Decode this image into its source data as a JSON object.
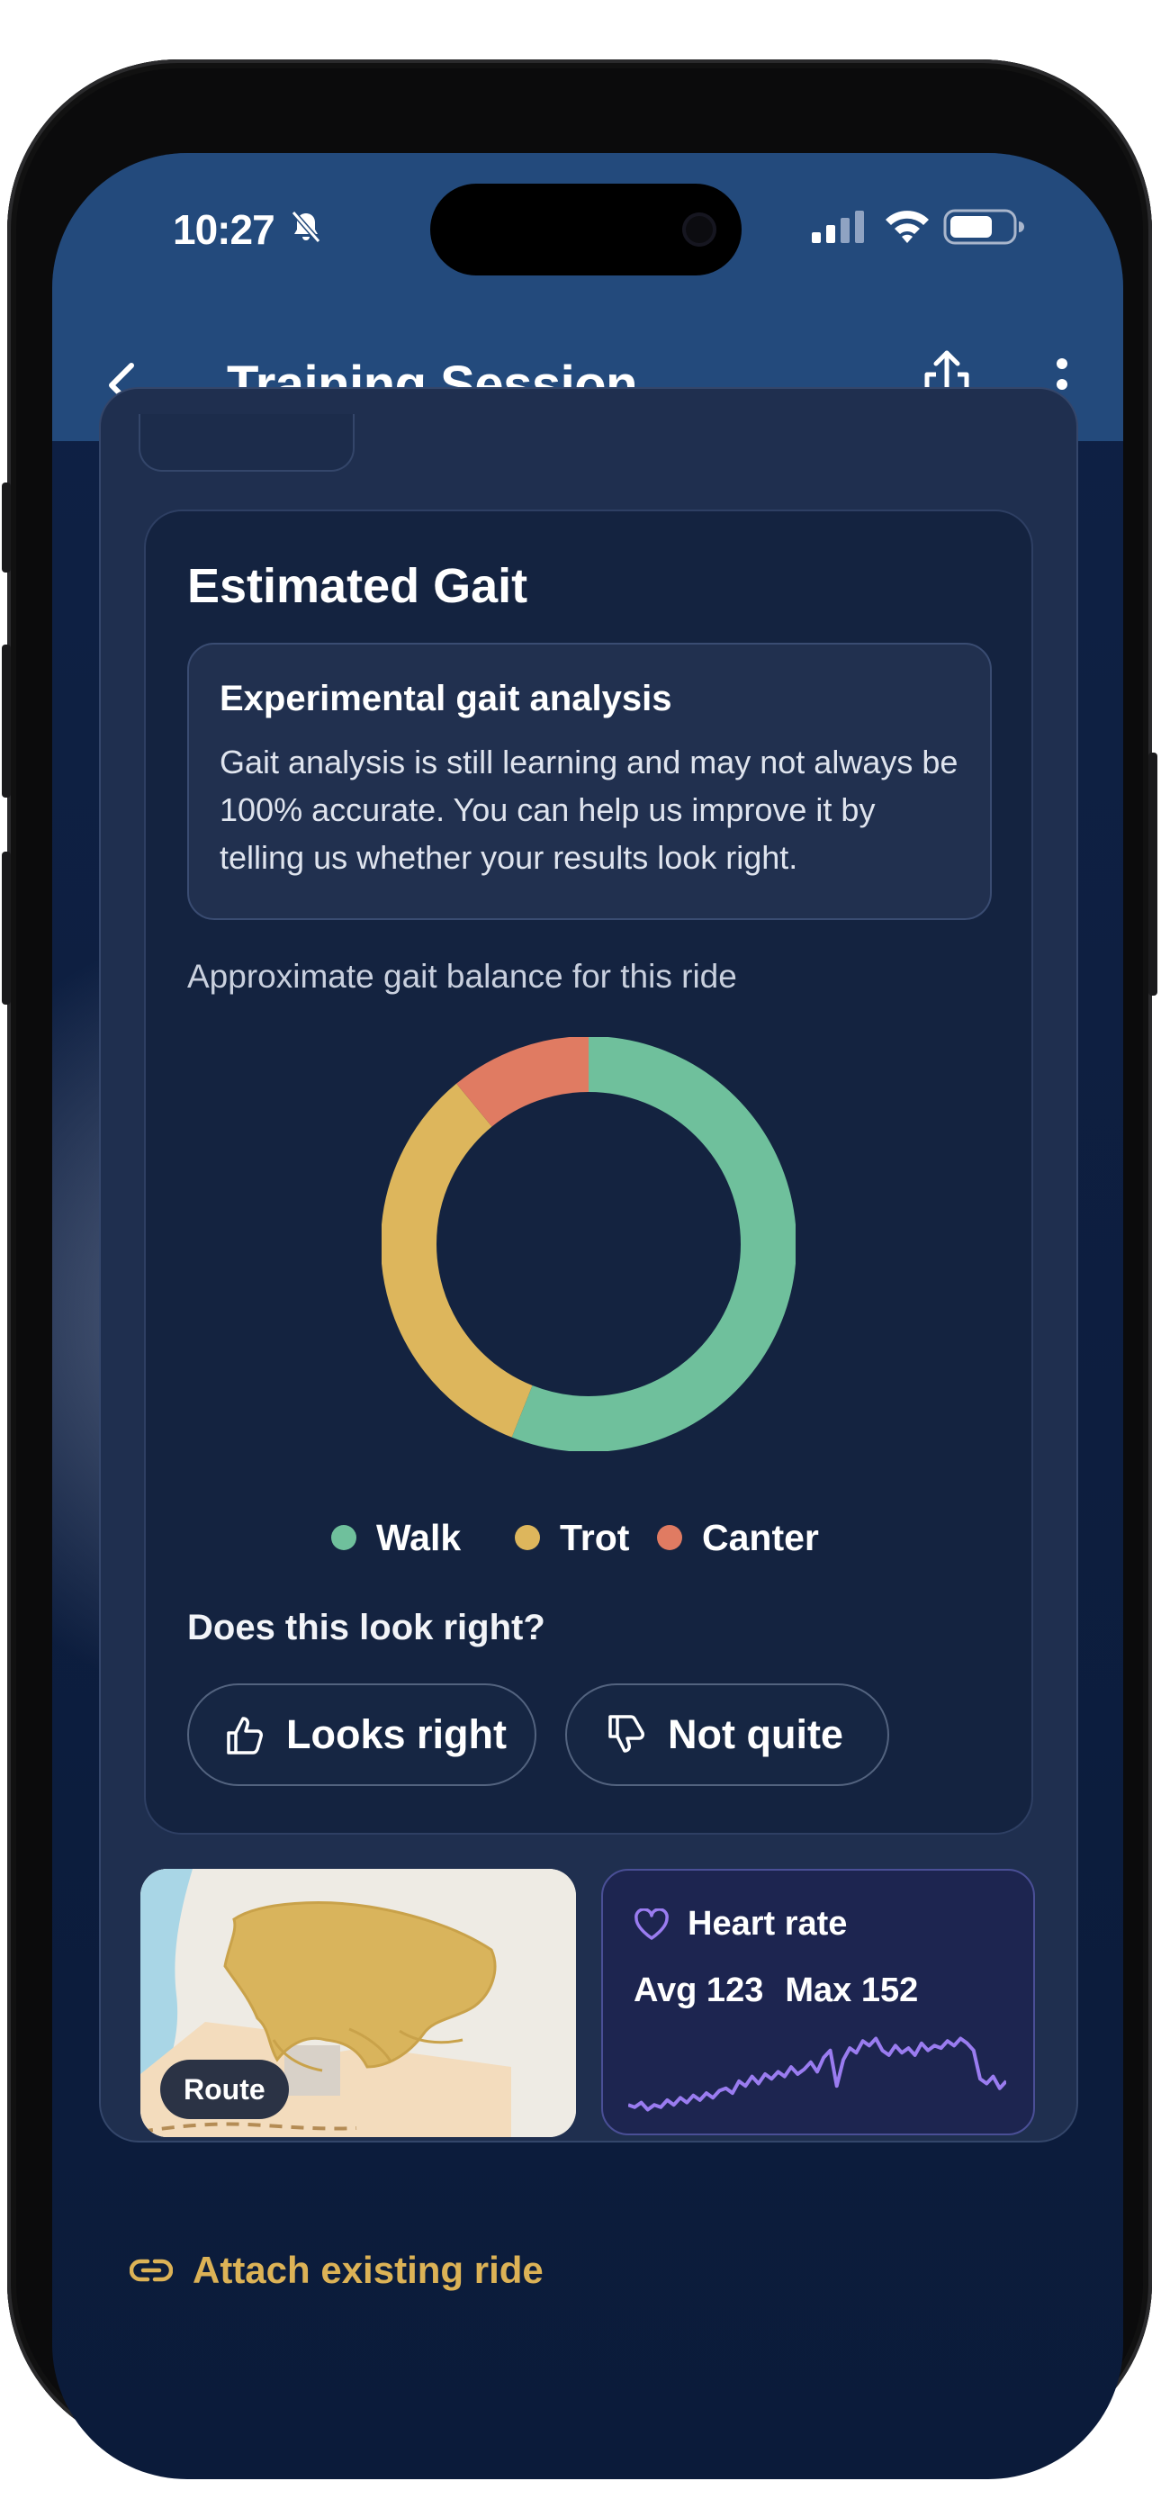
{
  "status_bar": {
    "time": "10:27",
    "icons": [
      "bell-slash-icon",
      "cellular-signal-icon",
      "wifi-icon",
      "battery-icon"
    ]
  },
  "app_bar": {
    "title": "Training Session",
    "back_icon": "chevron-left-icon",
    "share_icon": "share-icon",
    "more_icon": "more-vertical-icon"
  },
  "gait": {
    "title": "Estimated Gait",
    "notice_title": "Experimental gait analysis",
    "notice_body": "Gait analysis is still learning and may not always be 100% accurate. You can help us improve it by telling us whether your results look right.",
    "chart_caption": "Approximate gait balance for this ride",
    "question": "Does this look right?",
    "looks_right_label": "Looks right",
    "not_quite_label": "Not quite"
  },
  "chart_data": {
    "type": "pie",
    "donut": true,
    "categories": [
      "Walk",
      "Trot",
      "Canter"
    ],
    "values": [
      56,
      33,
      11
    ],
    "colors": [
      "#6fc09c",
      "#ddb65c",
      "#e07b62"
    ],
    "legend_position": "bottom"
  },
  "route": {
    "label": "Route",
    "colors": {
      "track": "#d9b45c",
      "water": "#a9d6e6",
      "land": "#eeebe4",
      "area": "#f3dcbd"
    }
  },
  "heart_rate": {
    "title": "Heart rate",
    "avg": "Avg 123",
    "max": "Max 152",
    "color": "#9a7cf0",
    "series": [
      118,
      117,
      119,
      116,
      118,
      117,
      120,
      118,
      121,
      119,
      122,
      120,
      123,
      121,
      124,
      125,
      123,
      128,
      126,
      130,
      127,
      131,
      129,
      132,
      130,
      134,
      131,
      133,
      136,
      132,
      138,
      141,
      126,
      137,
      142,
      140,
      145,
      143,
      146,
      141,
      139,
      143,
      140,
      142,
      139,
      144,
      141,
      143,
      142,
      145,
      143,
      146,
      144,
      141,
      129,
      127,
      130,
      125,
      128
    ]
  },
  "attach": {
    "label": "Attach existing ride",
    "icon": "link-icon"
  },
  "theme": {
    "header_bg": "#234a7c",
    "accent_gold": "#dcb256"
  }
}
